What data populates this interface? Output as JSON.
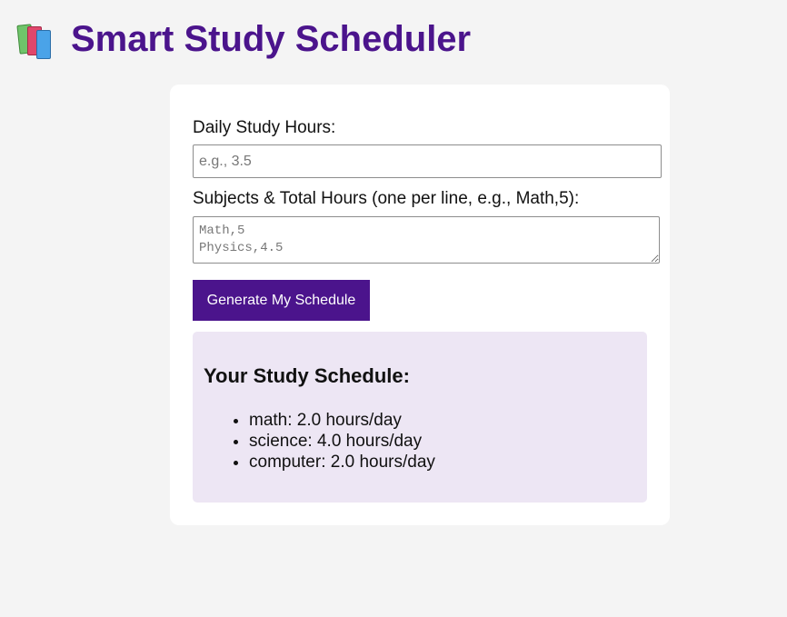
{
  "header": {
    "icon": "books-icon",
    "title": "Smart Study Scheduler"
  },
  "form": {
    "daily_hours_label": "Daily Study Hours:",
    "daily_hours_placeholder": "e.g., 3.5",
    "daily_hours_value": "",
    "subjects_label": "Subjects & Total Hours (one per line, e.g., Math,5):",
    "subjects_placeholder": "Math,5\nPhysics,4.5",
    "subjects_value": "",
    "generate_button_label": "Generate My Schedule"
  },
  "schedule": {
    "title": "Your Study Schedule:",
    "items": [
      "math: 2.0 hours/day",
      "science: 4.0 hours/day",
      "computer: 2.0 hours/day"
    ]
  },
  "colors": {
    "accent": "#4b148c",
    "background": "#f4f4f4",
    "result_background": "#ede6f4"
  }
}
